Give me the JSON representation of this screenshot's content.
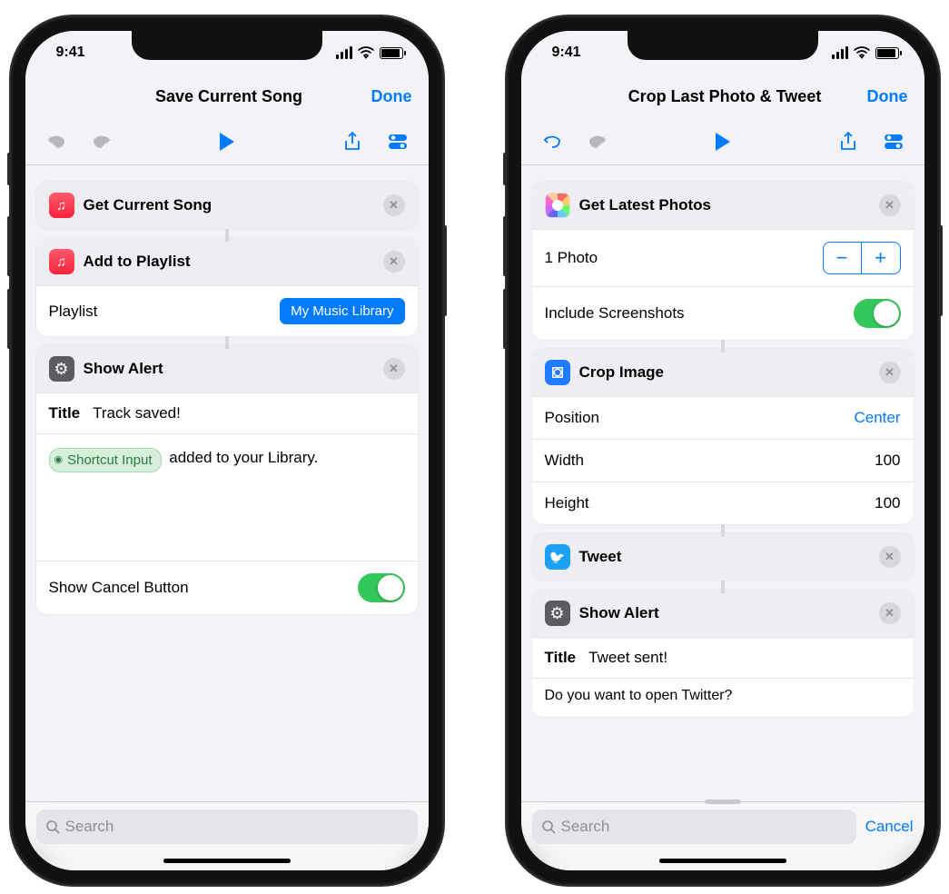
{
  "statusbar": {
    "time": "9:41"
  },
  "phone1": {
    "nav": {
      "title": "Save Current Song",
      "done": "Done"
    },
    "actions": {
      "a1": {
        "title": "Get Current Song"
      },
      "a2": {
        "title": "Add to Playlist",
        "param_label": "Playlist",
        "param_value": "My Music Library"
      },
      "a3": {
        "title": "Show Alert",
        "title_label": "Title",
        "title_value": "Track saved!",
        "token": "Shortcut Input",
        "msg_suffix": " added to your Library.",
        "toggle_label": "Show Cancel Button",
        "toggle_on": true
      }
    },
    "search_placeholder": "Search"
  },
  "phone2": {
    "nav": {
      "title": "Crop Last Photo & Tweet",
      "done": "Done"
    },
    "actions": {
      "a1": {
        "title": "Get Latest Photos",
        "count_label": "1 Photo",
        "inc_label": "Include Screenshots",
        "inc_on": true
      },
      "a2": {
        "title": "Crop Image",
        "pos_label": "Position",
        "pos_value": "Center",
        "w_label": "Width",
        "w_value": "100",
        "h_label": "Height",
        "h_value": "100"
      },
      "a3": {
        "title": "Tweet"
      },
      "a4": {
        "title": "Show Alert",
        "title_label": "Title",
        "title_value": "Tweet sent!",
        "body": "Do you want to open Twitter?"
      }
    },
    "search_placeholder": "Search",
    "cancel": "Cancel"
  }
}
